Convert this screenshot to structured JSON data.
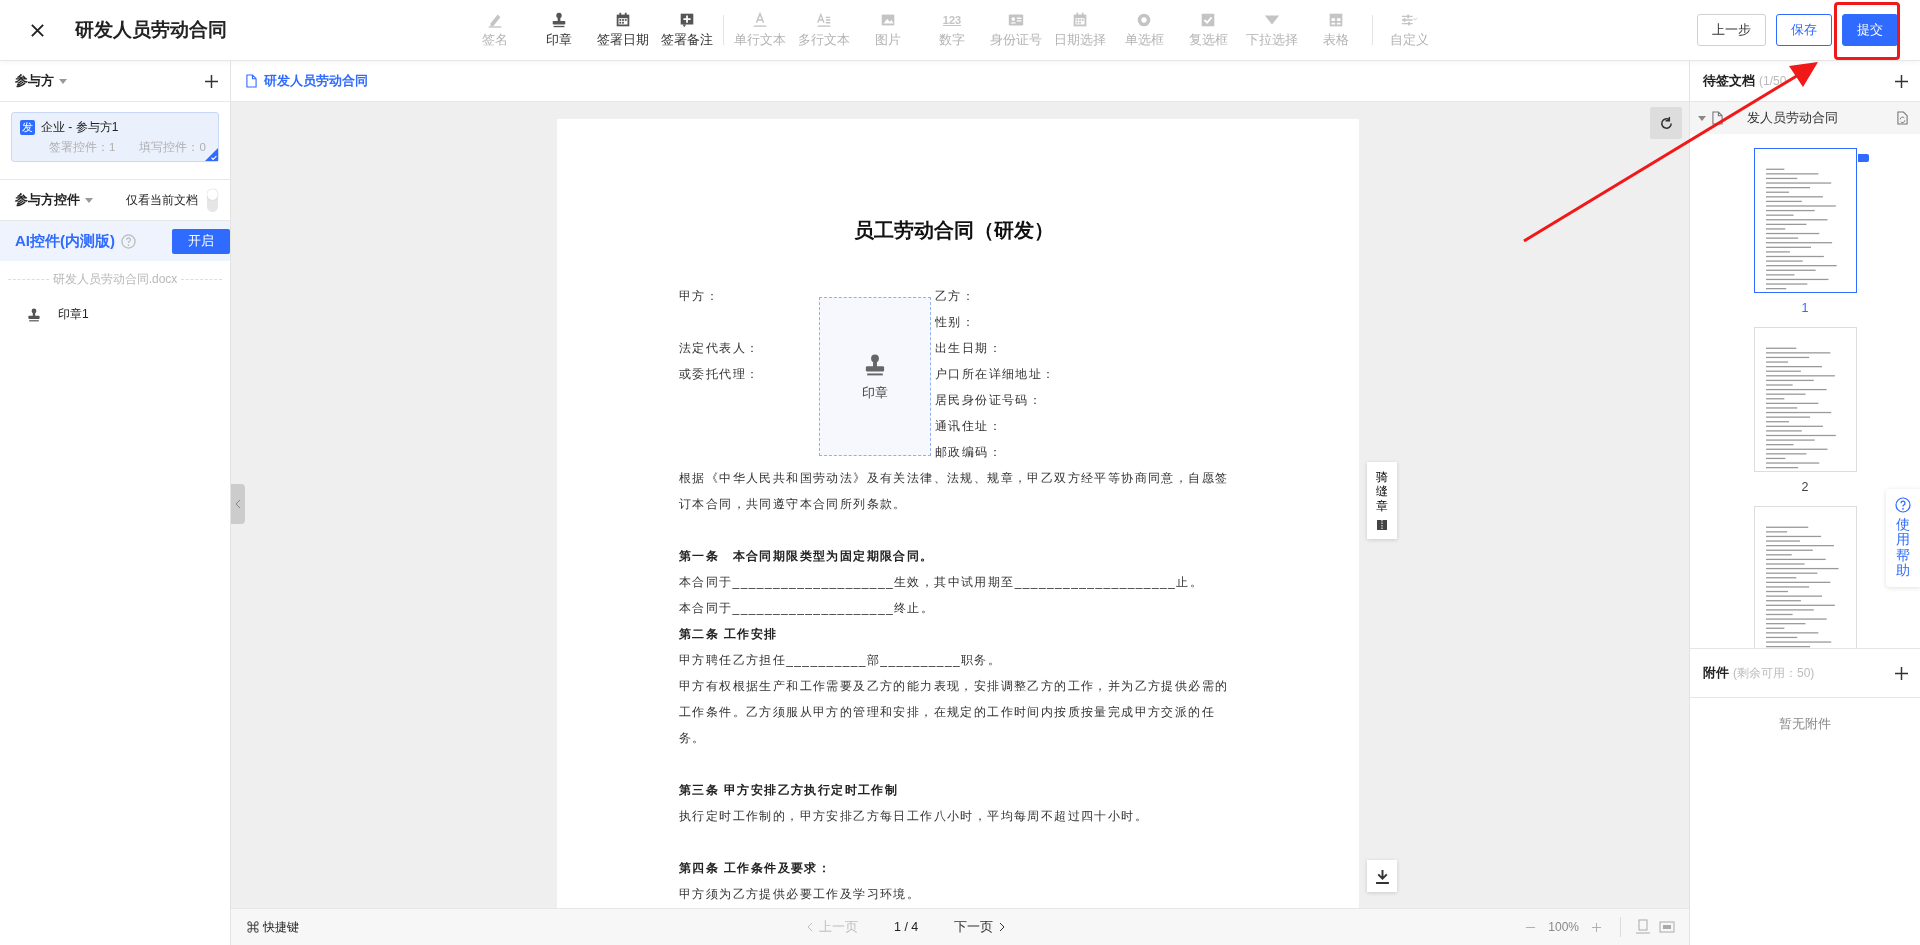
{
  "header": {
    "title": "研发人员劳动合同"
  },
  "toolbar": [
    {
      "kind": "signature",
      "label": "签名",
      "disabled": true
    },
    {
      "kind": "stamp",
      "label": "印章",
      "disabled": false
    },
    {
      "kind": "date",
      "label": "签署日期",
      "disabled": false
    },
    {
      "kind": "note",
      "label": "签署备注",
      "disabled": false
    },
    {
      "kind": "single_text",
      "label": "单行文本",
      "disabled": true,
      "separator_before": true
    },
    {
      "kind": "multi_text",
      "label": "多行文本",
      "disabled": true
    },
    {
      "kind": "image",
      "label": "图片",
      "disabled": true
    },
    {
      "kind": "number",
      "label": "数字",
      "disabled": true,
      "icon_text": "123"
    },
    {
      "kind": "id_card",
      "label": "身份证号",
      "disabled": true
    },
    {
      "kind": "date_pick",
      "label": "日期选择",
      "disabled": true
    },
    {
      "kind": "radio",
      "label": "单选框",
      "disabled": true
    },
    {
      "kind": "checkbox",
      "label": "复选框",
      "disabled": true
    },
    {
      "kind": "dropdown",
      "label": "下拉选择",
      "disabled": true
    },
    {
      "kind": "table",
      "label": "表格",
      "disabled": true
    },
    {
      "kind": "custom",
      "label": "自定义",
      "disabled": true,
      "separator_before": true
    }
  ],
  "actions": [
    {
      "kind": "default",
      "label": "上一步"
    },
    {
      "kind": "outline",
      "label": "保存"
    },
    {
      "kind": "primary",
      "label": "提交"
    }
  ],
  "participants": {
    "title": "参与方",
    "items": [
      {
        "badge": "发",
        "name": "企业 - 参与方1",
        "sign_count": "签署控件：1",
        "fill_count": "填写控件：0",
        "selected": true
      }
    ]
  },
  "controls": {
    "title": "参与方控件",
    "filter_label": "仅看当前文档",
    "filter_on": false
  },
  "ai": {
    "title": "AI控件(内测版)",
    "button": "开启"
  },
  "files": [
    {
      "name": "研发人员劳动合同.docx",
      "items": [
        {
          "kind": "stamp",
          "label": "印章1"
        }
      ]
    }
  ],
  "document_tab": "研发人员劳动合同",
  "document": {
    "title": "员工劳动合同（研发）",
    "field_rows": [
      {
        "left": "甲方：",
        "right": "乙方："
      },
      {
        "right": "性别："
      },
      {
        "left": "法定代表人：",
        "right": "出生日期："
      },
      {
        "left": "或委托代理：",
        "right": "户口所在详细地址："
      },
      {
        "right": "居民身份证号码："
      },
      {
        "right": "通讯住址："
      },
      {
        "right": "邮政编码："
      }
    ],
    "stamp_field": {
      "label": "印章"
    },
    "sections": [
      {
        "lines": [
          {
            "kind": "text",
            "text": "根据《中华人民共和国劳动法》及有关法律、法规、规章，甲乙双方经平等协商同意，自愿签"
          },
          {
            "kind": "text",
            "text": "订本合同，共同遵守本合同所列条款。"
          }
        ]
      },
      {
        "lines": [
          {
            "kind": "heading",
            "text": "第一条　本合同期限类型为固定期限合同。"
          },
          {
            "kind": "text",
            "text": "本合同于____________________生效，其中试用期至____________________止。"
          },
          {
            "kind": "text",
            "text": "本合同于____________________终止。"
          },
          {
            "kind": "heading",
            "text": "第二条 工作安排"
          },
          {
            "kind": "text",
            "text": "甲方聘任乙方担任__________部__________职务。"
          },
          {
            "kind": "text",
            "text": "甲方有权根据生产和工作需要及乙方的能力表现，安排调整乙方的工作，并为乙方提供必需的"
          },
          {
            "kind": "text",
            "text": "工作条件。乙方须服从甲方的管理和安排，在规定的工作时间内按质按量完成甲方交派的任"
          },
          {
            "kind": "text",
            "text": "务。"
          }
        ]
      },
      {
        "lines": [
          {
            "kind": "heading",
            "text": "第三条 甲方安排乙方执行定时工作制"
          },
          {
            "kind": "text",
            "text": "执行定时工作制的，甲方安排乙方每日工作八小时，平均每周不超过四十小时。"
          }
        ]
      },
      {
        "lines": [
          {
            "kind": "heading",
            "text": "第四条 工作条件及要求："
          },
          {
            "kind": "text",
            "text": "甲方须为乙方提供必要工作及学习环境。"
          }
        ]
      }
    ]
  },
  "seam_stamp": {
    "label": "骑缝章"
  },
  "pager": {
    "shortcut": "快捷键",
    "prev": "上一页",
    "prev_disabled": true,
    "page": "1 / 4",
    "next": "下一页",
    "next_disabled": false,
    "zoom": "100%"
  },
  "documents": {
    "title": "待签文档",
    "count": "(1/50",
    "tree": {
      "name": "发人员劳动合同",
      "expanded": true,
      "pages": [
        {
          "number": "1",
          "selected": true
        },
        {
          "number": "2",
          "selected": false
        },
        {
          "selected": false
        }
      ]
    }
  },
  "attachments": {
    "title": "附件",
    "note": "(剩余可用：50)",
    "empty": "暂无附件"
  },
  "help": {
    "label": "使用帮助"
  }
}
